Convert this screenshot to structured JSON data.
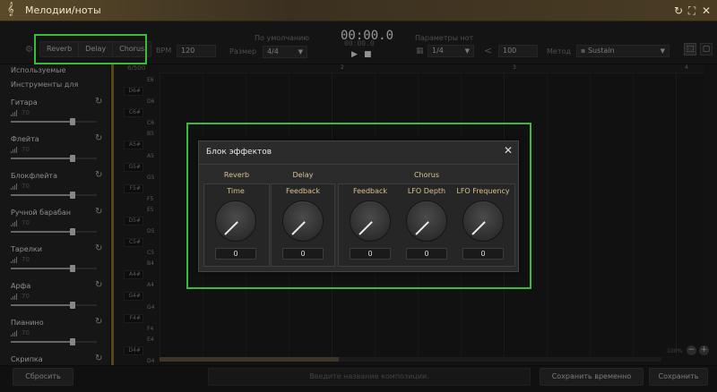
{
  "window": {
    "title": "Мелодии/ноты",
    "icon": "treble-clef-icon"
  },
  "toolbar": {
    "fx_tabs": [
      "Reverb",
      "Delay",
      "Chorus"
    ],
    "bpm_label": "BPM",
    "bpm_value": "120",
    "default_label": "По умолчанию",
    "size_label": "Размер",
    "size_value": "4/4",
    "time_main": "00:00.0",
    "time_sub": "00:00.0",
    "note_params_label": "Параметры нот",
    "note_value": "1/4",
    "velocity_value": "100",
    "method_label": "Метод",
    "method_value": "Sustain"
  },
  "sidebar": {
    "header_used": "Используемые",
    "header_instruments": "Инструменты для",
    "counter": "6/500",
    "instruments": [
      {
        "name": "Гитара",
        "volume": "70",
        "level": 0.72
      },
      {
        "name": "Флейта",
        "volume": "70",
        "level": 0.72
      },
      {
        "name": "Блокфлейта",
        "volume": "70",
        "level": 0.72
      },
      {
        "name": "Ручной барабан",
        "volume": "70",
        "level": 0.72
      },
      {
        "name": "Тарелки",
        "volume": "70",
        "level": 0.72
      },
      {
        "name": "Арфа",
        "volume": "70",
        "level": 0.72
      },
      {
        "name": "Пианино",
        "volume": "70",
        "level": 0.72
      },
      {
        "name": "Скрипка",
        "volume": "",
        "level": 0.72
      }
    ]
  },
  "piano_roll": {
    "keys": [
      "E6",
      "D6#",
      "D6",
      "C6#",
      "C6",
      "B5",
      "A5#",
      "A5",
      "G5#",
      "G5",
      "F5#",
      "F5",
      "E5",
      "D5#",
      "D5",
      "C5#",
      "C5",
      "B4",
      "A4#",
      "A4",
      "G4#",
      "G4",
      "F4#",
      "F4",
      "E4",
      "D4#",
      "D4"
    ],
    "black_keys": [
      "D6#",
      "C6#",
      "A5#",
      "G5#",
      "F5#",
      "D5#",
      "C5#",
      "A4#",
      "G4#",
      "F4#",
      "D4#"
    ],
    "ruler": [
      "2",
      "3",
      "4"
    ],
    "zoom": "100%"
  },
  "bottom": {
    "reset": "Сбросить",
    "name_placeholder": "Введите название композиции.",
    "save_temp": "Сохранить временно",
    "save": "Сохранить"
  },
  "modal": {
    "title": "Блок эффектов",
    "groups": [
      {
        "title": "Reverb",
        "params": [
          {
            "label": "Time",
            "value": "0"
          }
        ]
      },
      {
        "title": "Delay",
        "params": [
          {
            "label": "Feedback",
            "value": "0"
          }
        ]
      },
      {
        "title": "Chorus",
        "params": [
          {
            "label": "Feedback",
            "value": "0"
          },
          {
            "label": "LFO Depth",
            "value": "0"
          },
          {
            "label": "LFO Frequency",
            "value": "0"
          }
        ]
      }
    ]
  },
  "colors": {
    "highlight": "#3bbb3b",
    "accent": "#d6c28e"
  }
}
